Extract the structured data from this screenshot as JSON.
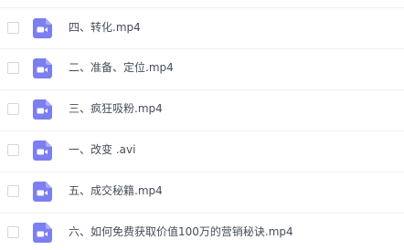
{
  "colors": {
    "icon_fill": "#7b7ff0",
    "text": "#454d5a",
    "divider": "#eef0f3"
  },
  "file_icon": "video-file-icon",
  "files": [
    {
      "name": "四、转化.mp4"
    },
    {
      "name": "二、准备、定位.mp4"
    },
    {
      "name": "三、疯狂吸粉.mp4"
    },
    {
      "name": "一、改变 .avi"
    },
    {
      "name": "五、成交秘籍.mp4"
    },
    {
      "name": "六、如何免费获取价值100万的营销秘诀.mp4"
    }
  ]
}
